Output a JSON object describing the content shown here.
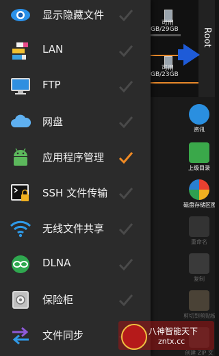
{
  "drawer": {
    "items": [
      {
        "label": "显示隐藏文件",
        "icon": "eye-icon",
        "checked": false
      },
      {
        "label": "LAN",
        "icon": "lan-icon",
        "checked": false
      },
      {
        "label": "FTP",
        "icon": "monitor-icon",
        "checked": false
      },
      {
        "label": "网盘",
        "icon": "cloud-icon",
        "checked": false
      },
      {
        "label": "应用程序管理",
        "icon": "android-icon",
        "checked": true
      },
      {
        "label": "SSH 文件传输",
        "icon": "terminal-lock-icon",
        "checked": false
      },
      {
        "label": "无线文件共享",
        "icon": "wifi-icon",
        "checked": false
      },
      {
        "label": "DLNA",
        "icon": "dlna-icon",
        "checked": false
      },
      {
        "label": "保险柜",
        "icon": "safe-icon",
        "checked": false
      },
      {
        "label": "文件同步",
        "icon": "sync-arrows-icon",
        "checked": false
      }
    ]
  },
  "background": {
    "root_label": "Root",
    "storage": [
      {
        "available_label": "可用",
        "size": "GB/29GB"
      },
      {
        "available_label": "可用",
        "size": "GB/23GB"
      }
    ],
    "side_buttons": [
      {
        "label": "资讯",
        "icon": "info-icon"
      },
      {
        "label": "上级目录",
        "icon": "up-arrow-icon"
      },
      {
        "label": "磁盘存储区图",
        "icon": "pie-chart-icon"
      },
      {
        "label": "重命名",
        "icon": "rename-icon"
      },
      {
        "label": "复制",
        "icon": "copy-icon"
      },
      {
        "label": "剪切到剪贴板",
        "icon": "clipboard-icon"
      },
      {
        "label": "创建 ZIP 文",
        "icon": "zip-icon"
      }
    ]
  },
  "watermark": {
    "line1": "八神智能天下",
    "line2": "zntx.cc"
  },
  "colors": {
    "drawer_bg": "#2b2b2b",
    "check_on": "#f08a24",
    "check_off": "#4a4a4a",
    "accent_blue": "#1e5bd8"
  }
}
